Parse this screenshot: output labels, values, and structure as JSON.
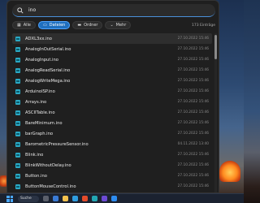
{
  "search": {
    "query": "ino"
  },
  "filters": {
    "items": [
      {
        "label": "Alle",
        "icon": "grid-icon",
        "active": false
      },
      {
        "label": "Dateien",
        "icon": "file-icon",
        "active": true
      },
      {
        "label": "Ordner",
        "icon": "folder-icon",
        "active": false
      },
      {
        "label": "Mehr",
        "icon": "chevron-down-icon",
        "active": false
      }
    ],
    "result_count": "173 Einträge"
  },
  "files": [
    {
      "name": "ADXL3xx.ino",
      "date": "27.10.2022 15:46"
    },
    {
      "name": "AnalogInOutSerial.ino",
      "date": "27.10.2022 15:46"
    },
    {
      "name": "AnalogInput.ino",
      "date": "27.10.2022 15:46"
    },
    {
      "name": "AnalogReadSerial.ino",
      "date": "27.10.2022 15:46"
    },
    {
      "name": "AnalogWriteMega.ino",
      "date": "27.10.2022 15:46"
    },
    {
      "name": "ArduinoISP.ino",
      "date": "27.10.2022 15:46"
    },
    {
      "name": "Arrays.ino",
      "date": "27.10.2022 15:46"
    },
    {
      "name": "ASCIITable.ino",
      "date": "27.10.2022 15:46"
    },
    {
      "name": "BareMinimum.ino",
      "date": "27.10.2022 15:46"
    },
    {
      "name": "barGraph.ino",
      "date": "27.10.2022 15:46"
    },
    {
      "name": "BarometricPressureSensor.ino",
      "date": "04.11.2022 13:40"
    },
    {
      "name": "Blink.ino",
      "date": "27.10.2022 15:46"
    },
    {
      "name": "BlinkWithoutDelay.ino",
      "date": "27.10.2022 15:46"
    },
    {
      "name": "Button.ino",
      "date": "27.10.2022 15:46"
    },
    {
      "name": "ButtonMouseControl.ino",
      "date": "27.10.2022 15:46"
    }
  ],
  "taskbar": {
    "search_label": "Suche"
  },
  "colors": {
    "accent": "#1f6fbf",
    "file_icon": "#2aa9c5"
  }
}
